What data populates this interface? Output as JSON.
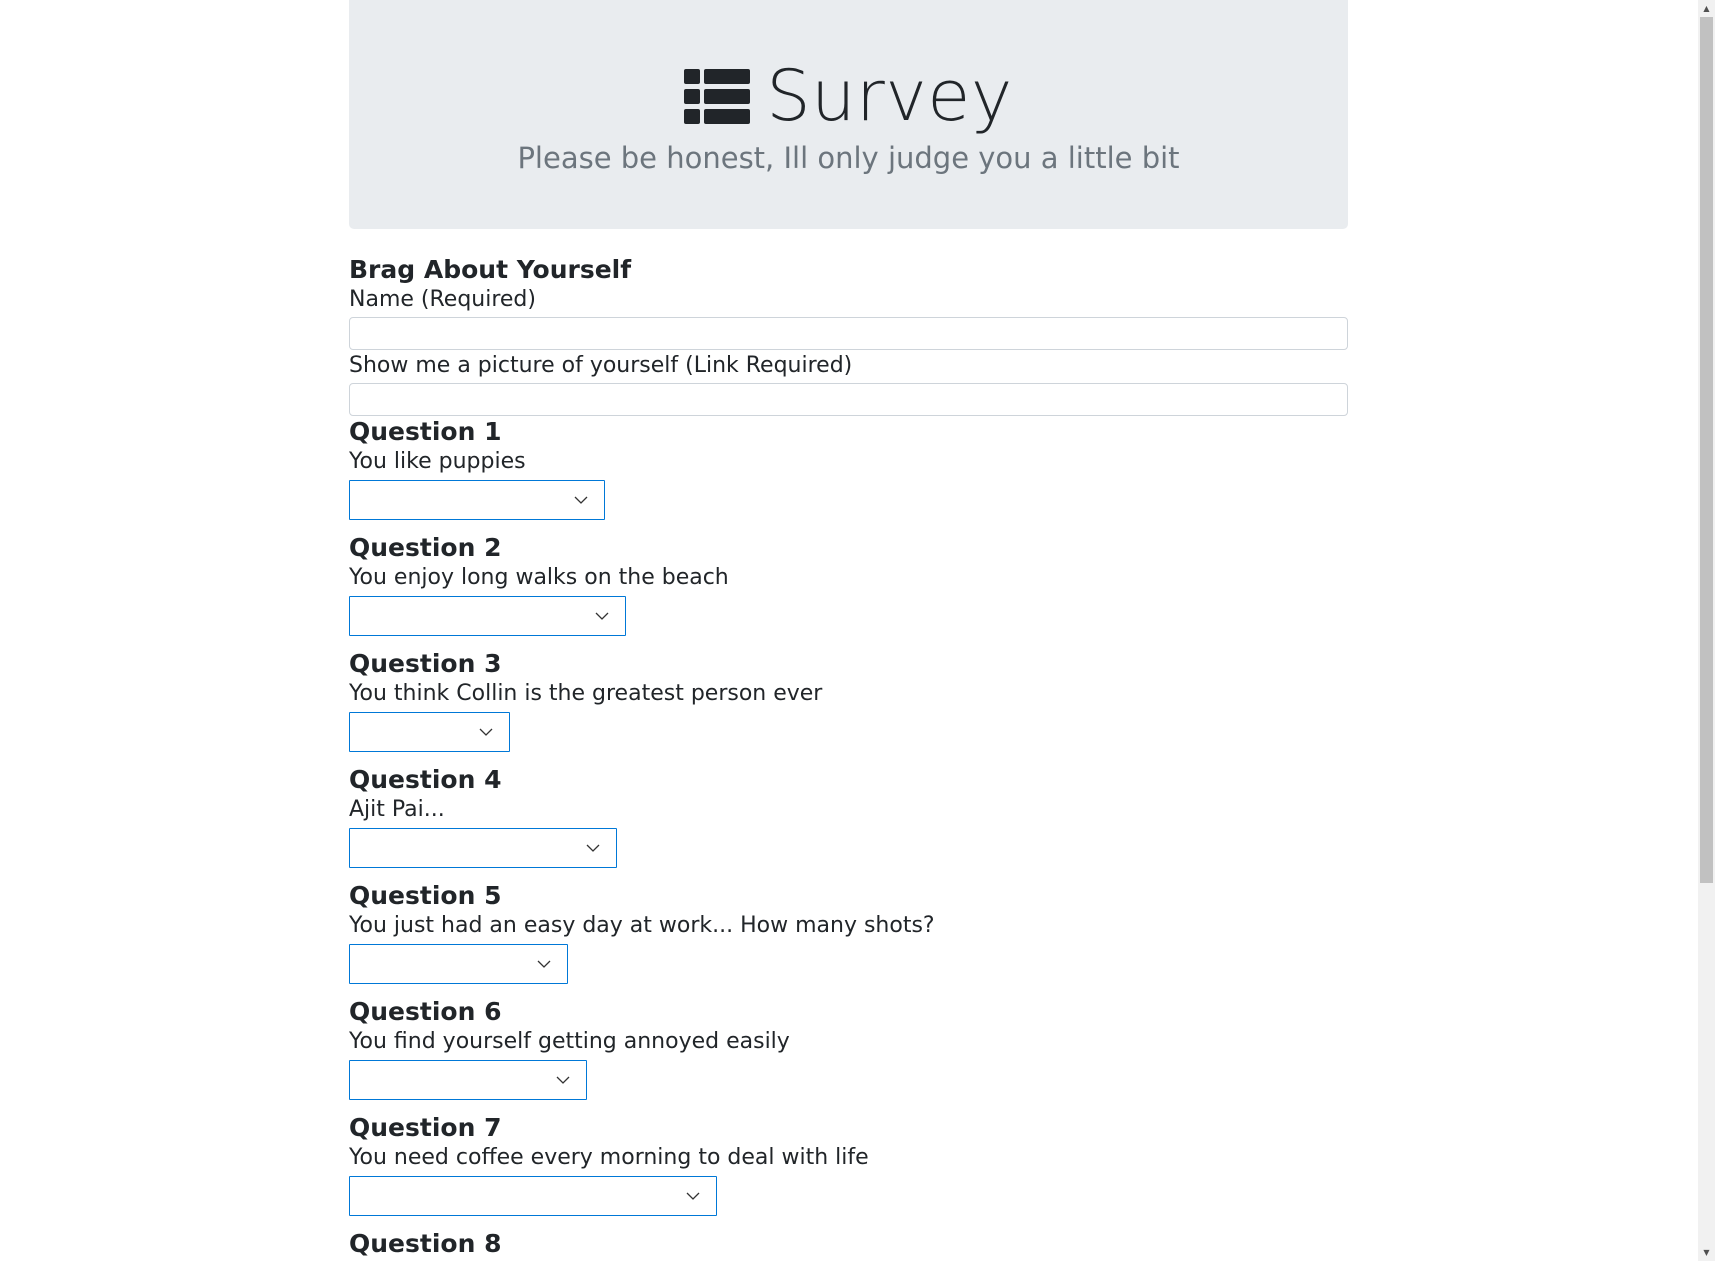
{
  "header": {
    "title": "Survey",
    "subtitle": "Please be honest, Ill only judge you a little bit",
    "icon": "list-icon"
  },
  "form": {
    "section_title": "Brag About Yourself",
    "name_label": "Name (Required)",
    "name_value": "",
    "photo_label": "Show me a picture of yourself (Link Required)",
    "photo_value": "",
    "questions": [
      {
        "title": "Question 1",
        "text": "You like puppies",
        "selected": ""
      },
      {
        "title": "Question 2",
        "text": "You enjoy long walks on the beach",
        "selected": ""
      },
      {
        "title": "Question 3",
        "text": "You think Collin is the greatest person ever",
        "selected": ""
      },
      {
        "title": "Question 4",
        "text": "Ajit Pai...",
        "selected": ""
      },
      {
        "title": "Question 5",
        "text": "You just had an easy day at work... How many shots?",
        "selected": ""
      },
      {
        "title": "Question 6",
        "text": "You find yourself getting annoyed easily",
        "selected": ""
      },
      {
        "title": "Question 7",
        "text": "You need coffee every morning to deal with life",
        "selected": ""
      },
      {
        "title": "Question 8"
      }
    ]
  },
  "colors": {
    "jumbotron_bg": "#e9ecef",
    "select_border": "#0078d7",
    "subtitle": "#6c757d"
  }
}
